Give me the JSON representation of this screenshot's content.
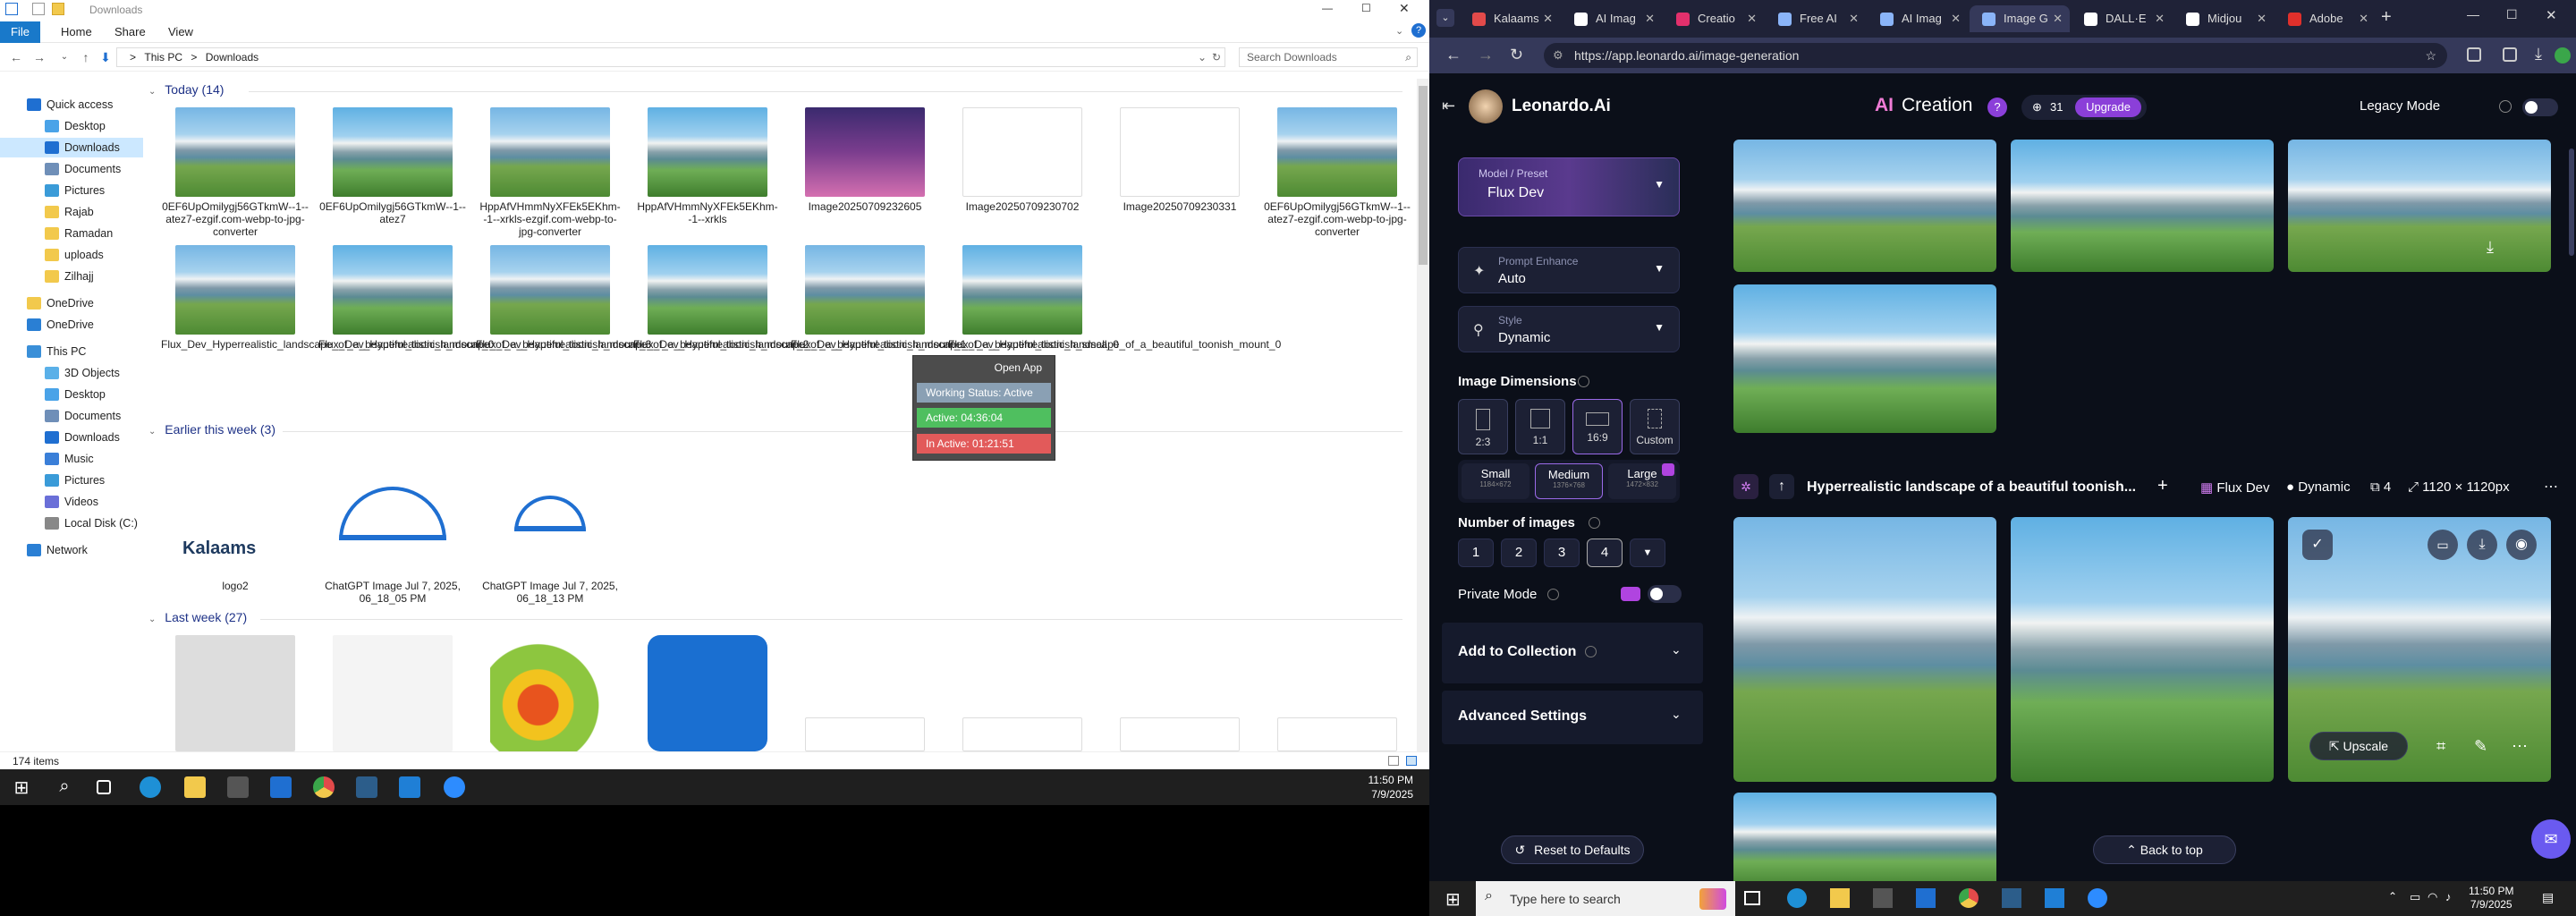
{
  "explorer": {
    "title": "Downloads",
    "ribbon": {
      "file": "File",
      "home": "Home",
      "share": "Share",
      "view": "View"
    },
    "address": {
      "this_pc": "This PC",
      "downloads": "Downloads",
      "sep": ">"
    },
    "search_placeholder": "Search Downloads",
    "nav": [
      {
        "label": "Quick access",
        "color": "#1f6fd1"
      },
      {
        "label": "Desktop",
        "color": "#4aa3e8"
      },
      {
        "label": "Downloads",
        "color": "#1f6fd1"
      },
      {
        "label": "Documents",
        "color": "#6f8fb8"
      },
      {
        "label": "Pictures",
        "color": "#3a9bd8"
      },
      {
        "label": "Rajab",
        "color": "#f2c94c"
      },
      {
        "label": "Ramadan",
        "color": "#f2c94c"
      },
      {
        "label": "uploads",
        "color": "#f2c94c"
      },
      {
        "label": "Zilhajj",
        "color": "#f2c94c"
      },
      {
        "label": "OneDrive",
        "color": "#f2c94c"
      },
      {
        "label": "OneDrive",
        "color": "#2a7fd4"
      },
      {
        "label": "This PC",
        "color": "#3a8fd8"
      },
      {
        "label": "3D Objects",
        "color": "#5ab0e8"
      },
      {
        "label": "Desktop",
        "color": "#4aa3e8"
      },
      {
        "label": "Documents",
        "color": "#6f8fb8"
      },
      {
        "label": "Downloads",
        "color": "#1f6fd1"
      },
      {
        "label": "Music",
        "color": "#3a7fd8"
      },
      {
        "label": "Pictures",
        "color": "#3a9bd8"
      },
      {
        "label": "Videos",
        "color": "#6a6fd8"
      },
      {
        "label": "Local Disk (C:)",
        "color": "#888888"
      },
      {
        "label": "Network",
        "color": "#2a7fd4"
      }
    ],
    "groups": {
      "today": "Today (14)",
      "week": "Earlier this week (3)",
      "last": "Last week (27)"
    },
    "today_files": [
      "0EF6UpOmilygj56GTkmW--1--atez7-ezgif.com-webp-to-jpg-converter",
      "0EF6UpOmilygj56GTkmW--1--atez7",
      "HppAfVHmmNyXFEk5EKhm--1--xrkls-ezgif.com-webp-to-jpg-converter",
      "HppAfVHmmNyXFEk5EKhm--1--xrkls",
      "Image20250709232605",
      "Image20250709230702",
      "Image20250709230331",
      "0EF6UpOmilygj56GTkmW--1--atez7-ezgif.com-webp-to-jpg-converter",
      "Flux_Dev_Hyperrealistic_landscape_of_a_beautiful_toonish_mount_0",
      "Flux_Dev_Hyperrealistic_landscape_of_a_beautiful_toonish_mount_3",
      "Flux_Dev_Hyperrealistic_landscape_of_a_beautiful_toonish_mount_2",
      "Flux_Dev_Hyperrealistic_landscape_of_a_beautiful_toonish_mount_1",
      "Flux_Dev_Hyperrealistic_landscape_of_a_beautiful_toonish_small_0",
      "Flux_Dev_Hyperrealistic_landscape_of_a_beautiful_toonish_mount_0"
    ],
    "week_files": [
      "logo2",
      "ChatGPT Image Jul 7, 2025, 06_18_05 PM",
      "ChatGPT Image Jul 7, 2025, 06_18_13 PM"
    ],
    "logo_text": "Kalaams",
    "status": "174 items"
  },
  "status_widget": {
    "open_app": "Open App",
    "working": "Working Status: Active",
    "active": "Active: 04:36:04",
    "inactive": "In Active: 01:21:51"
  },
  "taskbar": {
    "time": "11:50 PM",
    "date": "7/9/2025",
    "search_placeholder": "Type here to search"
  },
  "browser": {
    "tabs": [
      {
        "label": "Kalaams",
        "color": "#e24a4a"
      },
      {
        "label": "AI Imag",
        "color": "#ffffff"
      },
      {
        "label": "Creatio",
        "color": "#e2306c"
      },
      {
        "label": "Free AI",
        "color": "#8ab4f8"
      },
      {
        "label": "AI Imag",
        "color": "#8ab4f8"
      },
      {
        "label": "Image G",
        "color": "#8ab4f8"
      },
      {
        "label": "DALL·E",
        "color": "#ffffff"
      },
      {
        "label": "Midjou",
        "color": "#ffffff"
      },
      {
        "label": "Adobe",
        "color": "#e0302b"
      }
    ],
    "url": "https://app.leonardo.ai/image-generation"
  },
  "leonardo": {
    "brand": "Leonardo.Ai",
    "page_title_ai": "AI",
    "page_title_rest": "Creation",
    "tokens": "31",
    "upgrade": "Upgrade",
    "legacy": "Legacy Mode",
    "model_label": "Model / Preset",
    "model_value": "Flux Dev",
    "enhance_label": "Prompt Enhance",
    "enhance_value": "Auto",
    "style_label": "Style",
    "style_value": "Dynamic",
    "dims_title": "Image Dimensions",
    "dims": [
      "2:3",
      "1:1",
      "16:9",
      "Custom"
    ],
    "sizes": [
      {
        "l": "Small",
        "s": "1184×672"
      },
      {
        "l": "Medium",
        "s": "1376×768"
      },
      {
        "l": "Large",
        "s": "1472×832"
      }
    ],
    "num_title": "Number of images",
    "nums": [
      "1",
      "2",
      "3",
      "4"
    ],
    "private": "Private Mode",
    "collection": "Add to Collection",
    "advanced": "Advanced Settings",
    "reset": "Reset to Defaults",
    "prompt": "Hyperrealistic landscape of a beautiful toonish...",
    "meta_model": "Flux Dev",
    "meta_style": "Dynamic",
    "meta_count": "4",
    "meta_size": "1120 × 1120px",
    "upscale": "Upscale",
    "back_top": "Back to top"
  }
}
